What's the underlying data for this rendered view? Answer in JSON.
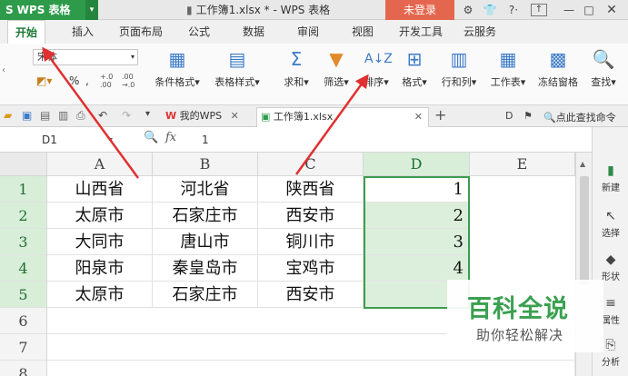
{
  "app": {
    "name": "WPS 表格",
    "document_title": "工作簿1.xlsx * - WPS 表格",
    "login_label": "未登录"
  },
  "menu": {
    "tabs": [
      "开始",
      "插入",
      "页面布局",
      "公式",
      "数据",
      "审阅",
      "视图",
      "开发工具",
      "云服务"
    ]
  },
  "ribbon": {
    "font_name": "宋体",
    "buttons": [
      "条件格式",
      "表格样式",
      "求和",
      "筛选",
      "排序",
      "格式",
      "行和列",
      "工作表",
      "冻结窗格",
      "查找"
    ]
  },
  "doc_tabs": {
    "wps_label": "我的WPS",
    "book_label": "工作簿1.xlsx",
    "search_label": "点此查找命令"
  },
  "formula": {
    "cell_ref": "D1",
    "fx_label": "fx",
    "value": "1"
  },
  "columns": [
    "A",
    "B",
    "C",
    "D",
    "E"
  ],
  "rows": [
    "1",
    "2",
    "3",
    "4",
    "5",
    "6",
    "7",
    "8"
  ],
  "cells": [
    [
      "山西省",
      "河北省",
      "陕西省",
      "1"
    ],
    [
      "太原市",
      "石家庄市",
      "西安市",
      "2"
    ],
    [
      "大同市",
      "唐山市",
      "铜川市",
      "3"
    ],
    [
      "阳泉市",
      "秦皇岛市",
      "宝鸡市",
      "4"
    ],
    [
      "太原市",
      "石家庄市",
      "西安市",
      ""
    ]
  ],
  "sidebar": {
    "items": [
      "新建",
      "选择",
      "形状",
      "属性",
      "分析"
    ]
  },
  "watermark": {
    "title": "百科全说",
    "subtitle": "助你轻松解决"
  },
  "colors": {
    "accent": "#2e9b4b",
    "login": "#e5664e",
    "annotation_arrow": "#e03030",
    "selection": "#3c9d4e"
  }
}
